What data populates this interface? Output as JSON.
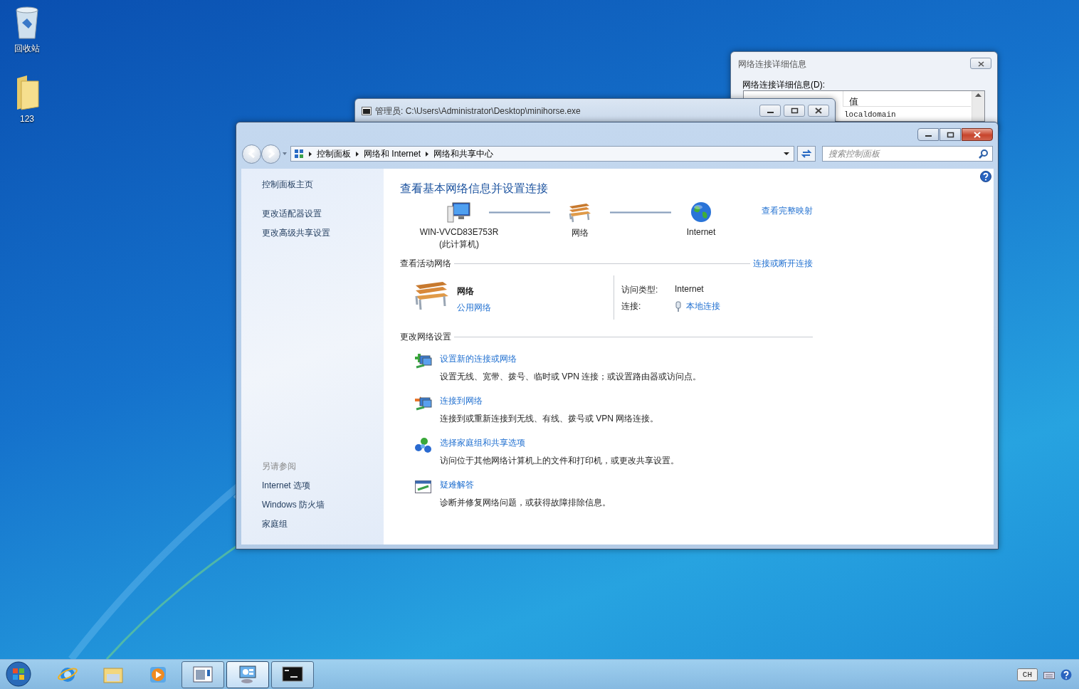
{
  "desktop_icons": [
    {
      "kind": "recycle-bin",
      "label": "回收站"
    },
    {
      "kind": "folder",
      "label": "123"
    }
  ],
  "details_window": {
    "title": "网络连接详细信息",
    "list_label": "网络连接详细信息(D):",
    "value_column": "值",
    "values": [
      "localdomain"
    ]
  },
  "console_window": {
    "title": "管理员: C:\\Users\\Administrator\\Desktop\\minihorse.exe"
  },
  "main_window": {
    "breadcrumb": [
      "控制面板",
      "网络和 Internet",
      "网络和共享中心"
    ],
    "search": {
      "placeholder": "搜索控制面板"
    },
    "sidebar": {
      "links": [
        "控制面板主页",
        "更改适配器设置",
        "更改高级共享设置"
      ],
      "see_also_title": "另请参阅",
      "see_also": [
        "Internet 选项",
        "Windows 防火墙",
        "家庭组"
      ]
    },
    "heading": "查看基本网络信息并设置连接",
    "map": {
      "nodes": [
        {
          "kind": "computer",
          "label": "WIN-VVCD83E753R",
          "sublabel": "(此计算机)"
        },
        {
          "kind": "bench",
          "label": "网络"
        },
        {
          "kind": "globe",
          "label": "Internet"
        }
      ],
      "full_map_link": "查看完整映射"
    },
    "active_networks": {
      "title": "查看活动网络",
      "action_link": "连接或断开连接",
      "network": {
        "name": "网络",
        "type_link": "公用网络",
        "access_label": "访问类型:",
        "access_value": "Internet",
        "connection_label": "连接:",
        "connection_link": "本地连接"
      }
    },
    "change_settings": {
      "title": "更改网络设置",
      "items": [
        {
          "kind": "new-connection",
          "link": "设置新的连接或网络",
          "description": "设置无线、宽带、拨号、临时或 VPN 连接；或设置路由器或访问点。"
        },
        {
          "kind": "connect",
          "link": "连接到网络",
          "description": "连接到或重新连接到无线、有线、拨号或 VPN 网络连接。"
        },
        {
          "kind": "homegroup",
          "link": "选择家庭组和共享选项",
          "description": "访问位于其他网络计算机上的文件和打印机，或更改共享设置。"
        },
        {
          "kind": "troubleshoot",
          "link": "疑难解答",
          "description": "诊断并修复网络问题，或获得故障排除信息。"
        }
      ]
    }
  },
  "taskbar": {
    "items": [
      {
        "kind": "browser",
        "running": false,
        "selected": false
      },
      {
        "kind": "explorer",
        "running": false,
        "selected": false
      },
      {
        "kind": "media",
        "running": false,
        "selected": false
      },
      {
        "kind": "window-app",
        "running": true,
        "selected": false
      },
      {
        "kind": "control-panel",
        "running": true,
        "selected": true
      },
      {
        "kind": "console",
        "running": true,
        "selected": false
      }
    ],
    "language": "CH"
  }
}
